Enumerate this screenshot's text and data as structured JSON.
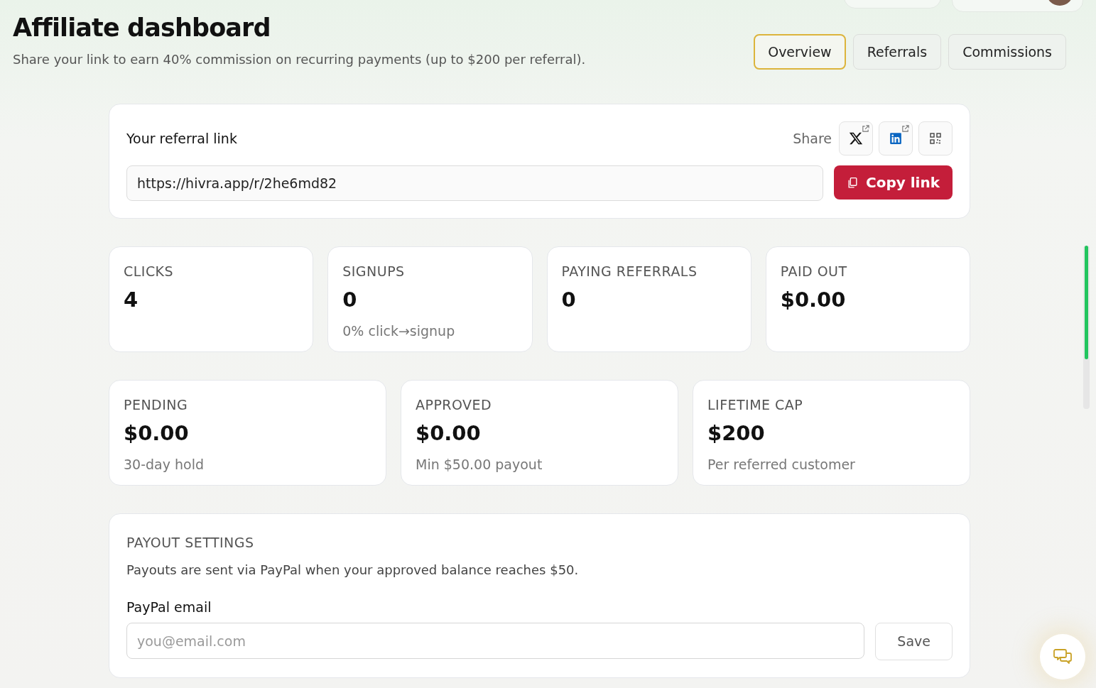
{
  "header": {
    "title": "Affiliate dashboard",
    "subtitle": "Share your link to earn 40% commission on recurring payments (up to $200 per referral)."
  },
  "tabs": [
    {
      "label": "Overview",
      "selected": true
    },
    {
      "label": "Referrals",
      "selected": false
    },
    {
      "label": "Commissions",
      "selected": false
    }
  ],
  "referral": {
    "title": "Your referral link",
    "share_label": "Share",
    "link": "https://hivra.app/r/2he6md82",
    "copy_button": "Copy link"
  },
  "stats": [
    {
      "label": "CLICKS",
      "value": "4"
    },
    {
      "label": "SIGNUPS",
      "value": "0",
      "note": "0% click→signup"
    },
    {
      "label": "PAYING REFERRALS",
      "value": "0"
    },
    {
      "label": "PAID OUT",
      "value": "$0.00"
    }
  ],
  "balances": [
    {
      "label": "PENDING",
      "value": "$0.00",
      "note": "30-day hold"
    },
    {
      "label": "APPROVED",
      "value": "$0.00",
      "note": "Min $50.00 payout"
    },
    {
      "label": "LIFETIME CAP",
      "value": "$200",
      "note": "Per referred customer"
    }
  ],
  "payout": {
    "title": "PAYOUT SETTINGS",
    "description": "Payouts are sent via PayPal when your approved balance reaches $50.",
    "field_label": "PayPal email",
    "placeholder": "you@email.com",
    "save_button": "Save"
  }
}
